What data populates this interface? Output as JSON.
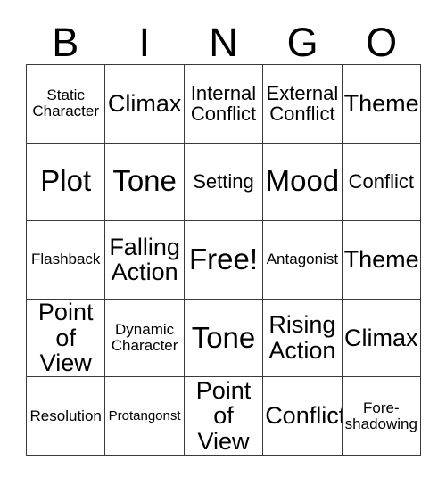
{
  "card": {
    "headers": [
      "B",
      "I",
      "N",
      "G",
      "O"
    ],
    "rows": [
      [
        {
          "text": "Static\nCharacter",
          "size": "fs-sm"
        },
        {
          "text": "Climax",
          "size": "fs-lg"
        },
        {
          "text": "Internal\nConflict",
          "size": "fs-md"
        },
        {
          "text": "External\nConflict",
          "size": "fs-md"
        },
        {
          "text": "Theme",
          "size": "fs-lg"
        }
      ],
      [
        {
          "text": "Plot",
          "size": "fs-xl"
        },
        {
          "text": "Tone",
          "size": "fs-xl"
        },
        {
          "text": "Setting",
          "size": "fs-md"
        },
        {
          "text": "Mood",
          "size": "fs-xl"
        },
        {
          "text": "Conflict",
          "size": "fs-md"
        }
      ],
      [
        {
          "text": "Flashback",
          "size": "fs-sm"
        },
        {
          "text": "Falling\nAction",
          "size": "fs-lg"
        },
        {
          "text": "Free!",
          "size": "fs-xl"
        },
        {
          "text": "Antagonist",
          "size": "fs-sm"
        },
        {
          "text": "Theme",
          "size": "fs-lg"
        }
      ],
      [
        {
          "text": "Point of\nView",
          "size": "fs-lg"
        },
        {
          "text": "Dynamic\nCharacter",
          "size": "fs-sm"
        },
        {
          "text": "Tone",
          "size": "fs-xl"
        },
        {
          "text": "Rising\nAction",
          "size": "fs-lg"
        },
        {
          "text": "Climax",
          "size": "fs-lg"
        }
      ],
      [
        {
          "text": "Resolution",
          "size": "fs-sm"
        },
        {
          "text": "Protangonst",
          "size": "fs-xs"
        },
        {
          "text": "Point of\nView",
          "size": "fs-lg"
        },
        {
          "text": "Conflict",
          "size": "fs-lg"
        },
        {
          "text": "Fore-\nshadowing",
          "size": "fs-sm"
        }
      ]
    ]
  },
  "colors": {
    "border": "#3a3a3a",
    "text": "#000000",
    "background": "#ffffff"
  }
}
